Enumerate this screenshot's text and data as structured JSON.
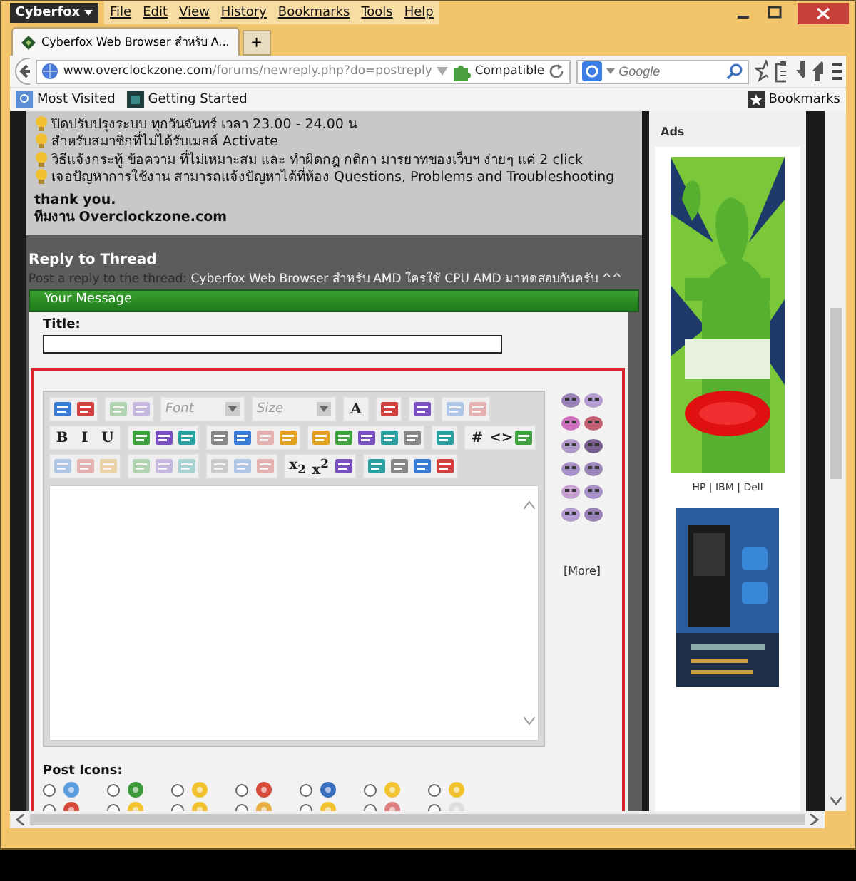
{
  "window": {
    "app_button": "Cyberfox",
    "menu": [
      "File",
      "Edit",
      "View",
      "History",
      "Bookmarks",
      "Tools",
      "Help"
    ]
  },
  "tabs": [
    {
      "title": "Cyberfox Web Browser สำหรับ A...",
      "selected": true
    }
  ],
  "new_tab": "+",
  "address_bar": {
    "url_host": "www.overclockzone.com",
    "url_path": "/forums/newreply.php?do=postreply",
    "addon": "Compatible"
  },
  "search": {
    "placeholder": "Google"
  },
  "bookmarks_bar": {
    "items": [
      "Most Visited",
      "Getting Started"
    ],
    "menu": "Bookmarks"
  },
  "notice": {
    "lines": [
      "ปิดปรับปรุงระบบ ทุกวันจันทร์ เวลา 23.00 - 24.00 น",
      "สำหรับสมาชิกที่ไม่ได้รับเมลล์ Activate",
      "วิธีแจ้งกระทู้ ข้อความ ที่ไม่เหมาะสม และ ทำผิดกฎ กติกา มารยาทของเว็บฯ ง่ายๆ แค่ 2 click",
      "เจอปัญหาการใช้งาน สามารถแจ้งปัญหาได้ที่ห้อง Questions, Problems and Troubleshooting"
    ],
    "signoff": [
      "thank you.",
      "ทีมงาน Overclockzone.com"
    ]
  },
  "reply": {
    "heading": "Reply to Thread",
    "prefix": "Post a reply to the thread:",
    "thread": "Cyberfox Web Browser สำหรับ AMD ใครใช้ CPU AMD มาทดสอบกันครับ ^^"
  },
  "message": {
    "header": "Your Message",
    "title_label": "Title:",
    "toolbar": [
      [
        [
          {
            "kind": "icon",
            "disabled": false
          },
          {
            "kind": "icon",
            "disabled": false
          }
        ],
        [
          {
            "kind": "icon",
            "disabled": true
          },
          {
            "kind": "icon",
            "disabled": true
          }
        ],
        [
          {
            "kind": "dropdown",
            "label": "Font",
            "disabled": false
          }
        ],
        [
          {
            "kind": "dropdown",
            "label": "Size",
            "disabled": false
          }
        ],
        [
          {
            "kind": "text",
            "label": "A",
            "disabled": false
          }
        ],
        [
          {
            "kind": "icon",
            "disabled": false
          }
        ],
        [
          {
            "kind": "icon",
            "disabled": false
          }
        ],
        [
          {
            "kind": "icon",
            "disabled": true
          },
          {
            "kind": "icon",
            "disabled": true
          }
        ]
      ],
      [
        [
          {
            "kind": "text",
            "label": "B",
            "disabled": false
          },
          {
            "kind": "text",
            "label": "I",
            "disabled": false
          },
          {
            "kind": "text",
            "label": "U",
            "disabled": false
          }
        ],
        [
          {
            "kind": "icon",
            "disabled": false
          },
          {
            "kind": "icon",
            "disabled": false
          },
          {
            "kind": "icon",
            "disabled": false
          }
        ],
        [
          {
            "kind": "icon",
            "disabled": false
          },
          {
            "kind": "icon",
            "disabled": false
          },
          {
            "kind": "icon",
            "disabled": true
          },
          {
            "kind": "icon",
            "disabled": false
          }
        ],
        [
          {
            "kind": "icon",
            "disabled": false
          },
          {
            "kind": "icon",
            "disabled": false
          },
          {
            "kind": "icon",
            "disabled": false
          },
          {
            "kind": "icon",
            "disabled": false
          },
          {
            "kind": "icon",
            "disabled": false
          }
        ],
        [
          {
            "kind": "icon",
            "disabled": false
          }
        ],
        [
          {
            "kind": "text",
            "label": "#",
            "disabled": false
          },
          {
            "kind": "text",
            "label": "<>",
            "disabled": false
          },
          {
            "kind": "icon",
            "disabled": false
          }
        ]
      ],
      [
        [
          {
            "kind": "icon",
            "disabled": true
          },
          {
            "kind": "icon",
            "disabled": true
          },
          {
            "kind": "icon",
            "disabled": true
          }
        ],
        [
          {
            "kind": "icon",
            "disabled": true
          },
          {
            "kind": "icon",
            "disabled": true
          },
          {
            "kind": "icon",
            "disabled": true
          }
        ],
        [
          {
            "kind": "icon",
            "disabled": true
          },
          {
            "kind": "icon",
            "disabled": true
          },
          {
            "kind": "icon",
            "disabled": true
          }
        ],
        [
          {
            "kind": "text",
            "label": "x$_{2}$",
            "disabled": false
          },
          {
            "kind": "text",
            "label": "x$^{2}$",
            "disabled": false
          },
          {
            "kind": "icon",
            "disabled": false
          }
        ],
        [
          {
            "kind": "icon",
            "disabled": false
          },
          {
            "kind": "icon",
            "disabled": false
          },
          {
            "kind": "icon",
            "disabled": false
          },
          {
            "kind": "icon",
            "disabled": false
          }
        ]
      ]
    ],
    "more": "[More]",
    "post_icons_label": "Post Icons:",
    "post_icons": [
      {
        "selected": false
      },
      {
        "selected": false
      },
      {
        "selected": false
      },
      {
        "selected": false
      },
      {
        "selected": false
      },
      {
        "selected": false
      },
      {
        "selected": false
      },
      {
        "selected": false
      },
      {
        "selected": false
      },
      {
        "selected": false
      },
      {
        "selected": false
      },
      {
        "selected": false
      },
      {
        "selected": false
      },
      {
        "selected": false
      }
    ]
  },
  "sidebar": {
    "title": "Ads",
    "ads": [
      {
        "kind": "picture",
        "caption": "HP | IBM | Dell"
      },
      {
        "kind": "picture"
      }
    ]
  }
}
